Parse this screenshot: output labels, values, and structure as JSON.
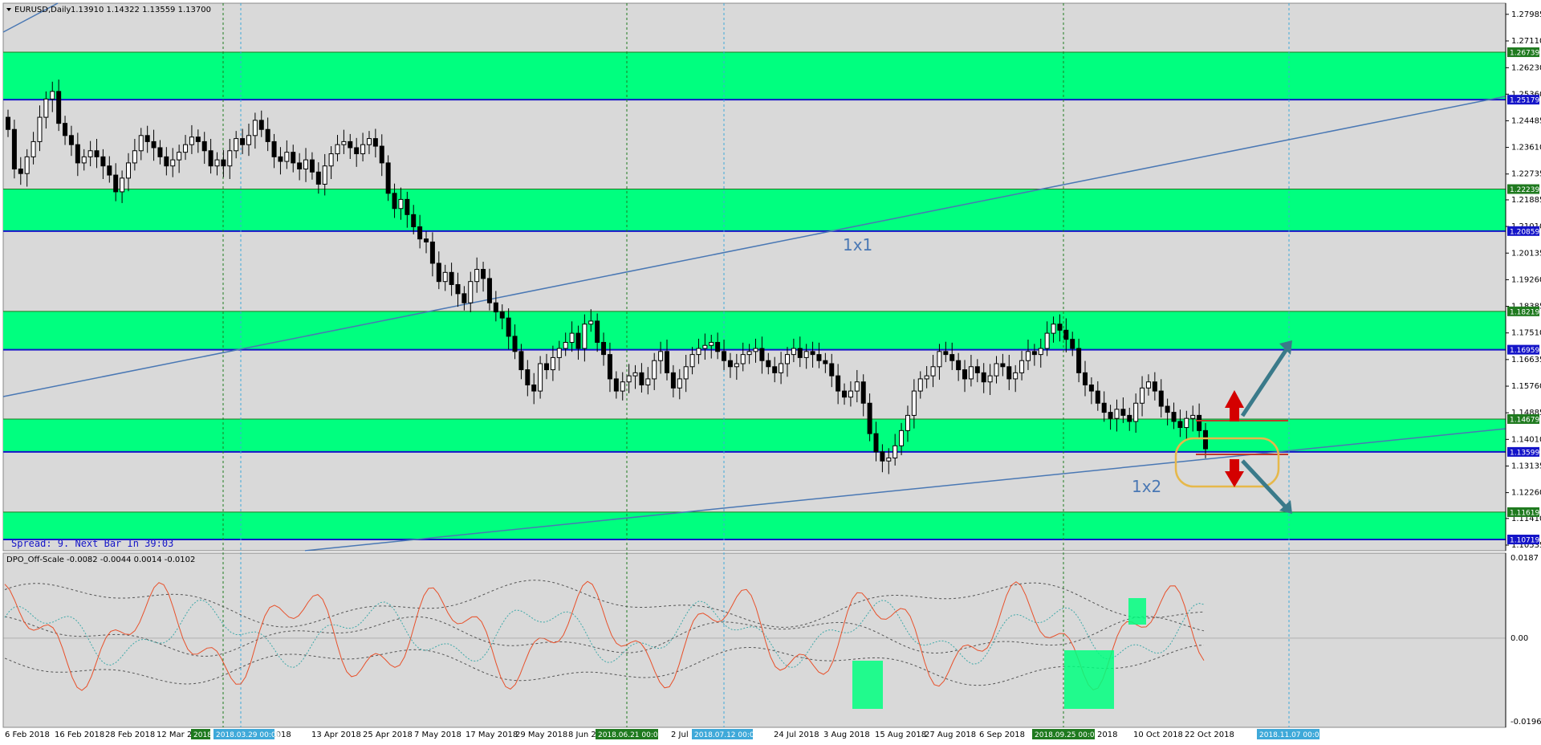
{
  "window": {
    "symbol_caption": "EURUSD,Daily",
    "ohlc_caption": "1.13910 1.14322 1.13559 1.13700",
    "spread_text": "Spread: 9.  Next Bar In 39:03",
    "indicator_caption": "DPO_Off-Scale -0.0082 -0.0044 0.0014 -0.0102"
  },
  "annotations": {
    "label_1x1": "1x1",
    "label_1x2": "1x2"
  },
  "colors": {
    "zone_fill": "#00ff7f",
    "blue_line": "#1414c8",
    "trend_line": "#4a78b4",
    "arrow_up": "#d40000",
    "arrow_teal": "#3a7a8a",
    "dpo_line": "#e8502a",
    "vline_green": "#1f7a1f",
    "vline_cyan": "#3fa9d9",
    "highlight_box": "#00ff7f",
    "ellipse": "#e6b84a"
  },
  "price_axis": {
    "ticks": [
      "1.27985",
      "1.27110",
      "1.26230",
      "1.25360",
      "1.24485",
      "1.23610",
      "1.22735",
      "1.21885",
      "1.21010",
      "1.20135",
      "1.19260",
      "1.18385",
      "1.17510",
      "1.16635",
      "1.15760",
      "1.14885",
      "1.14010",
      "1.13135",
      "1.12260",
      "1.11410",
      "1.10535"
    ],
    "tags": [
      {
        "text": "1.26739",
        "color": "#1f7a1f",
        "price": 1.26739
      },
      {
        "text": "1.25179",
        "color": "#1414c8",
        "price": 1.25179
      },
      {
        "text": "1.22239",
        "color": "#1f7a1f",
        "price": 1.22239
      },
      {
        "text": "1.20859",
        "color": "#1414c8",
        "price": 1.20859
      },
      {
        "text": "1.18219",
        "color": "#1f7a1f",
        "price": 1.18219
      },
      {
        "text": "1.16959",
        "color": "#1414c8",
        "price": 1.16959
      },
      {
        "text": "1.14679",
        "color": "#1f7a1f",
        "price": 1.14679
      },
      {
        "text": "1.13599",
        "color": "#1414c8",
        "price": 1.13599
      },
      {
        "text": "1.11619",
        "color": "#1f7a1f",
        "price": 1.11619
      },
      {
        "text": "1.10719",
        "color": "#1414c8",
        "price": 1.10719
      }
    ]
  },
  "indicator_axis": {
    "ticks": [
      "0.0187",
      "0.00",
      "-0.0196"
    ]
  },
  "zones": [
    {
      "top": 1.26739,
      "bottom": 1.25179
    },
    {
      "top": 1.22239,
      "bottom": 1.20859
    },
    {
      "top": 1.18219,
      "bottom": 1.16959
    },
    {
      "top": 1.14679,
      "bottom": 1.13599
    },
    {
      "top": 1.11619,
      "bottom": 1.10719
    }
  ],
  "date_axis": {
    "labels": [
      "6 Feb 2018",
      "16 Feb 2018",
      "28 Feb 2018",
      "12 Mar 20",
      "r 2018",
      "13 Apr 2018",
      "25 Apr 2018",
      "7 May 2018",
      "17 May 2018",
      "29 May 2018",
      "8 Jun 2",
      "2 Jul",
      "8",
      "24 Jul 2018",
      "3 Aug 2018",
      "15 Aug 2018",
      "27 Aug 2018",
      "6 Sep 2018",
      "Sep 2018",
      "10 Oct 2018",
      "22 Oct 2018"
    ],
    "badges": [
      {
        "text": "2018",
        "color": "#1f7a1f"
      },
      {
        "text": "2018.03.29 00:00",
        "color": "#3fa9d9"
      },
      {
        "text": "2018.06.21 00:00",
        "color": "#1f7a1f"
      },
      {
        "text": "2018.07.12 00:00",
        "color": "#3fa9d9"
      },
      {
        "text": "2018.09.25 00:00",
        "color": "#1f7a1f"
      },
      {
        "text": "2018.11.07 00:00",
        "color": "#3fa9d9"
      }
    ]
  },
  "chart_data": {
    "type": "candlestick",
    "symbol": "EURUSD",
    "timeframe": "Daily",
    "ylim": [
      1.1035,
      1.2835
    ],
    "closes": [
      1.242,
      1.229,
      1.2275,
      1.233,
      1.238,
      1.246,
      1.252,
      1.2545,
      1.244,
      1.24,
      1.237,
      1.231,
      1.233,
      1.235,
      1.233,
      1.23,
      1.227,
      1.2215,
      1.226,
      1.231,
      1.235,
      1.24,
      1.238,
      1.236,
      1.233,
      1.23,
      1.232,
      1.2345,
      1.237,
      1.2395,
      1.238,
      1.235,
      1.23,
      1.232,
      1.23,
      1.235,
      1.239,
      1.237,
      1.24,
      1.245,
      1.242,
      1.238,
      1.233,
      1.2315,
      1.2345,
      1.231,
      1.229,
      1.232,
      1.228,
      1.224,
      1.23,
      1.234,
      1.237,
      1.238,
      1.236,
      1.234,
      1.237,
      1.239,
      1.2365,
      1.231,
      1.221,
      1.216,
      1.219,
      1.214,
      1.21,
      1.206,
      1.205,
      1.198,
      1.192,
      1.195,
      1.191,
      1.188,
      1.185,
      1.192,
      1.196,
      1.193,
      1.185,
      1.182,
      1.18,
      1.174,
      1.169,
      1.163,
      1.158,
      1.156,
      1.165,
      1.163,
      1.167,
      1.17,
      1.172,
      1.175,
      1.17,
      1.178,
      1.179,
      1.172,
      1.168,
      1.16,
      1.156,
      1.159,
      1.161,
      1.162,
      1.158,
      1.16,
      1.166,
      1.169,
      1.162,
      1.157,
      1.16,
      1.164,
      1.168,
      1.17,
      1.171,
      1.172,
      1.169,
      1.166,
      1.164,
      1.165,
      1.168,
      1.169,
      1.17,
      1.166,
      1.164,
      1.162,
      1.165,
      1.168,
      1.17,
      1.167,
      1.169,
      1.168,
      1.166,
      1.165,
      1.161,
      1.156,
      1.154,
      1.156,
      1.159,
      1.152,
      1.142,
      1.136,
      1.133,
      1.134,
      1.138,
      1.143,
      1.148,
      1.156,
      1.16,
      1.161,
      1.164,
      1.169,
      1.168,
      1.166,
      1.163,
      1.16,
      1.164,
      1.162,
      1.159,
      1.161,
      1.165,
      1.164,
      1.16,
      1.162,
      1.166,
      1.169,
      1.168,
      1.17,
      1.175,
      1.178,
      1.176,
      1.173,
      1.17,
      1.162,
      1.158,
      1.156,
      1.152,
      1.149,
      1.147,
      1.15,
      1.148,
      1.146,
      1.152,
      1.157,
      1.159,
      1.156,
      1.151,
      1.149,
      1.146,
      1.144,
      1.147,
      1.148,
      1.143,
      1.137
    ],
    "vertical_lines": [
      {
        "label": "2018.03.29 00:00",
        "style": "green-dashed"
      },
      {
        "label": "2018.06.21 00:00",
        "style": "green-dashed"
      },
      {
        "label": "2018.07.12 00:00",
        "style": "cyan-dashed"
      },
      {
        "label": "2018.09.25 00:00",
        "style": "green-dashed"
      },
      {
        "label": "2018.11.07 00:00",
        "style": "cyan-dashed"
      }
    ],
    "indicator": {
      "name": "DPO_Off-Scale",
      "values": [
        -0.0082,
        -0.0044,
        0.0014,
        -0.0102
      ],
      "ylim": [
        -0.0196,
        0.0187
      ]
    }
  }
}
